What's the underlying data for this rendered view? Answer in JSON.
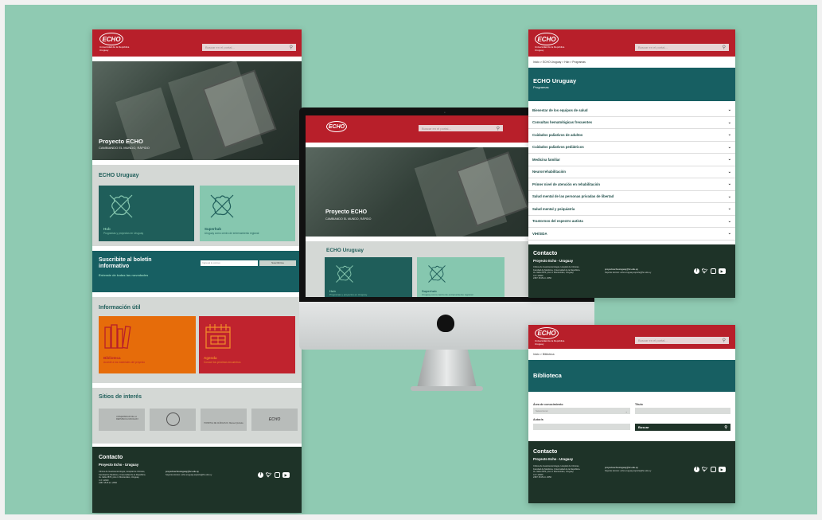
{
  "colors": {
    "background": "#8fcab2",
    "brand_red": "#b81f2a",
    "teal": "#1f5e5a",
    "mint": "#86c7af",
    "orange": "#e66c0a",
    "red_card": "#c0232e",
    "footer": "#1e3328"
  },
  "brand": {
    "logo": "ECHO",
    "logo_sub": "Universidad de la República Uruguay",
    "search_placeholder": "Buscar en el portal...",
    "search_icon": "search-icon"
  },
  "home": {
    "hero_title": "Proyecto ECHO",
    "hero_subtitle": "CAMBIANDO EL MUNDO, RÁPIDO",
    "section_echo": "ECHO Uruguay",
    "cards": [
      {
        "title": "Hub",
        "sub": "Programas y proyectos en Uruguay"
      },
      {
        "title": "Superhub",
        "sub": "Uruguay como centro de entrenamiento regional"
      }
    ],
    "newsletter_title": "Suscribite al boletín informativo",
    "newsletter_sub": "Enterate de todas las novedades",
    "newsletter_placeholder": "Ingresá tu correo",
    "newsletter_button": "Suscribirme",
    "info_title": "Información útil",
    "info_cards": [
      {
        "title": "Biblioteca",
        "sub": "Accedé a los materiales del proyecto"
      },
      {
        "title": "Agenda",
        "sub": "Conocé los próximos encuentros"
      }
    ],
    "sites_title": "Sitios de interés",
    "sites": [
      "UNIVERSIDAD DE LA REPÚBLICA URUGUAY",
      "",
      "HOSPITAL DE CLÍNICAS Dr. Manuel Quintela",
      "ECHO"
    ]
  },
  "footer": {
    "title": "Contacto",
    "org": "Proyecto Echo - Uruguay",
    "address": [
      "Clínica de Gastroenterología, Hospital de Clínicas,",
      "Facultad de Medicina, Universidad de la República.",
      "Av. Italia 2870, piso 4. Montevideo, Uruguay.",
      "C.P. 11600",
      "2487 1515 int. 2056"
    ],
    "emails": [
      "proyectoechouruguay@hc.edu.uy",
      "Soporte técnico: echo.uruguay.soporte@hc.edu.uy"
    ],
    "socials": [
      "facebook-icon",
      "twitter-icon",
      "instagram-icon",
      "youtube-icon"
    ]
  },
  "programs": {
    "breadcrumb": "Inicio > ECHO Uruguay > Hub > Programas",
    "title": "ECHO Uruguay",
    "subtitle": "Programas",
    "items": [
      "Bienestar de los equipos de salud",
      "Consultas hematológicas frecuentes",
      "Cuidados paliativos de adultos",
      "Cuidados paliativos pediátricos",
      "Medicina familiar",
      "Neurorrehabilitación",
      "Primer nivel de atención en rehabilitación",
      "Salud mental de las personas privadas de libertad",
      "Salud mental y psiquiatría",
      "Trastornos del espectro autista",
      "VIH/SIDA"
    ]
  },
  "library": {
    "breadcrumb": "Inicio > Biblioteca",
    "title": "Biblioteca",
    "area_label": "Área de conocimiento",
    "area_placeholder": "Seleccionar",
    "title_label": "Título",
    "author_label": "Autor/a",
    "search_button": "Buscar"
  },
  "monitor": {
    "camera": "•"
  }
}
